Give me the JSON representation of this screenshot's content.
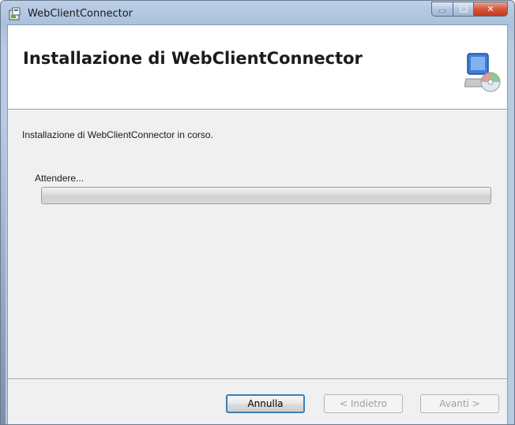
{
  "window": {
    "title": "WebClientConnector",
    "caption_buttons": {
      "minimize_icon": "minimize-icon",
      "maximize_icon": "maximize-icon",
      "close_icon": "close-icon",
      "close_glyph": "✕"
    }
  },
  "header": {
    "title": "Installazione di WebClientConnector",
    "icon": "computer-cd-icon"
  },
  "body": {
    "status": "Installazione di WebClientConnector in corso.",
    "wait_label": "Attendere...",
    "progress_fraction": 0.0
  },
  "footer": {
    "cancel_label": "Annulla",
    "back_label": "< Indietro",
    "next_label": "Avanti >"
  },
  "colors": {
    "accent": "#3c7fb1",
    "close_red": "#c23a1e",
    "client_bg": "#f0f0f0"
  }
}
